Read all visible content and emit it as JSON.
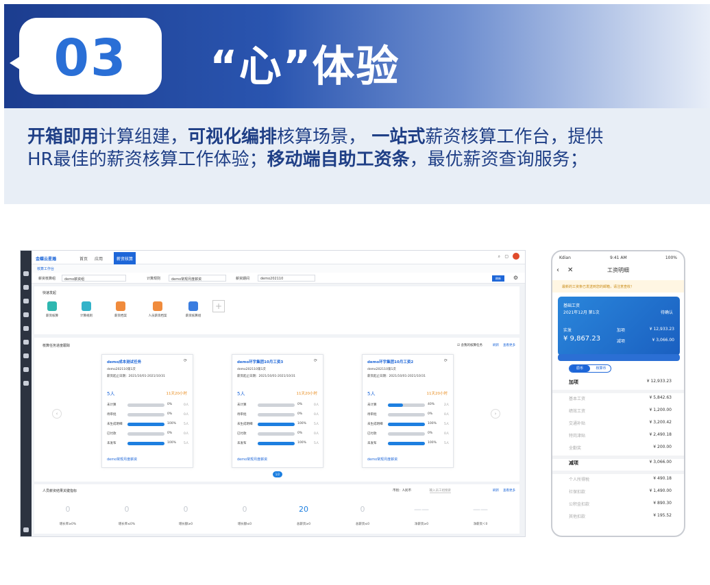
{
  "banner": {
    "number": "03",
    "title": "“心”体验"
  },
  "description": {
    "line1": [
      {
        "text": "开箱即用",
        "bold": true
      },
      {
        "text": "计算组建，",
        "bold": false
      },
      {
        "text": "可视化编排",
        "bold": true
      },
      {
        "text": "核算场景， ",
        "bold": false
      },
      {
        "text": "一站式",
        "bold": true
      },
      {
        "text": "薪资核算工作台，提供",
        "bold": false
      }
    ],
    "line2": [
      {
        "text": "HR最佳的薪资核算工作体验；",
        "bold": false
      },
      {
        "text": "移动端自助工资条",
        "bold": true
      },
      {
        "text": "，最优薪资查询服务；",
        "bold": false
      }
    ]
  },
  "desktop": {
    "logo": "金蝶云星瀚",
    "nav": [
      "首页",
      "应用"
    ],
    "active_tab": "薪资核算",
    "breadcrumb": "核算工作台",
    "filters": [
      {
        "label": "薪资核算组",
        "value": "demo薪资组"
      },
      {
        "label": "计算规则",
        "value": "demo常规月度薪资"
      },
      {
        "label": "薪资期间",
        "value": "demo202110"
      }
    ],
    "refresh_button": "刷新",
    "quick_title": "快速发起",
    "quick_actions": [
      {
        "label": "薪资核算",
        "color": "#2eb7b0"
      },
      {
        "label": "计算规则",
        "color": "#33b3c9"
      },
      {
        "label": "薪资档案",
        "color": "#f08b3c"
      },
      {
        "label": "人员薪资档案",
        "color": "#f08b3c"
      },
      {
        "label": "薪资核算组",
        "color": "#3a7de0"
      }
    ],
    "progress_title": "核算任务进度跟踪",
    "progress_options": [
      "含我的核算任务",
      "刷新",
      "查看更多"
    ],
    "cards": [
      {
        "title": "demo成本测试任务",
        "period_no": "demo202110第1次",
        "dates": "薪资起止日期：2021/10/01-2021/10/31",
        "count": "5人",
        "time": "11天20小时",
        "rows": [
          {
            "label": "未计算",
            "pct": 0,
            "pct_text": "0%",
            "people": "0人"
          },
          {
            "label": "待审批",
            "pct": 0,
            "pct_text": "0%",
            "people": "0人"
          },
          {
            "label": "未生成明细",
            "pct": 100,
            "pct_text": "100%",
            "people": "5人"
          },
          {
            "label": "已付款",
            "pct": 0,
            "pct_text": "0%",
            "people": "0人"
          },
          {
            "label": "未发布",
            "pct": 100,
            "pct_text": "100%",
            "people": "5人"
          }
        ],
        "footer": "demo常规月度薪资"
      },
      {
        "title": "demo环宇集团10月工资3",
        "period_no": "demo202110第1次",
        "dates": "薪资起止日期：2021/10/01-2021/10/31",
        "count": "5人",
        "time": "11天20小时",
        "rows": [
          {
            "label": "未计算",
            "pct": 0,
            "pct_text": "0%",
            "people": "0人"
          },
          {
            "label": "待审批",
            "pct": 0,
            "pct_text": "0%",
            "people": "0人"
          },
          {
            "label": "未生成明细",
            "pct": 100,
            "pct_text": "100%",
            "people": "5人"
          },
          {
            "label": "已付款",
            "pct": 0,
            "pct_text": "0%",
            "people": "0人"
          },
          {
            "label": "未发布",
            "pct": 100,
            "pct_text": "100%",
            "people": "5人"
          }
        ],
        "footer": "demo常规月度薪资"
      },
      {
        "title": "demo环宇集团10月工资2",
        "period_no": "demo202110第1次",
        "dates": "薪资起止日期：2021/10/01-2021/10/31",
        "count": "5人",
        "time": "11天20小时",
        "rows": [
          {
            "label": "未计算",
            "pct": 40,
            "pct_text": "40%",
            "people": "2人"
          },
          {
            "label": "待审批",
            "pct": 0,
            "pct_text": "0%",
            "people": "0人"
          },
          {
            "label": "未生成明细",
            "pct": 100,
            "pct_text": "100%",
            "people": "5人"
          },
          {
            "label": "已付款",
            "pct": 0,
            "pct_text": "0%",
            "people": "0人"
          },
          {
            "label": "未发布",
            "pct": 100,
            "pct_text": "100%",
            "people": "5人"
          }
        ],
        "footer": "demo常规月度薪资"
      }
    ],
    "page_indicator": "1/2",
    "results_title": "人员薪资结果关键指标",
    "results_options": [
      "币别：人民币",
      "输入员工组搜索",
      "刷新",
      "查看更多"
    ],
    "metrics": [
      {
        "value": "0",
        "label": "增长率≥0%"
      },
      {
        "value": "0",
        "label": "增长率≤0%"
      },
      {
        "value": "0",
        "label": "增长额≥0"
      },
      {
        "value": "0",
        "label": "增长额≤0"
      },
      {
        "value": "20",
        "label": "总薪资≥0"
      },
      {
        "value": "0",
        "label": "总薪资≤0"
      },
      {
        "value": "——",
        "label": "净薪资≥0"
      },
      {
        "value": "——",
        "label": "净薪资＜0"
      }
    ]
  },
  "phone": {
    "carrier": "Kdian",
    "time": "9:41 AM",
    "battery": "100%",
    "title": "工资明细",
    "notice": "最新的工资条已发送到您的邮箱，请注意查收！",
    "card": {
      "label": "基础工资",
      "period": "2021年12月 第1次",
      "sign": "待确认",
      "net_label": "实发",
      "net": "¥ 9,867.23",
      "add_label": "加项",
      "add_value": "¥ 12,933.23",
      "minus_label": "减项",
      "minus_value": "¥ 3,066.00"
    },
    "seg": [
      "原币",
      "核算币"
    ],
    "add_section": {
      "label": "加项",
      "value": "¥ 12,933.23"
    },
    "add_items": [
      {
        "label": "基本工资",
        "value": "¥ 5,842.63"
      },
      {
        "label": "绩效工资",
        "value": "¥ 1,200.00"
      },
      {
        "label": "交通补贴",
        "value": "¥ 3,200.42"
      },
      {
        "label": "特岗津贴",
        "value": "¥ 2,490.18"
      },
      {
        "label": "全勤奖",
        "value": "¥ 200.00"
      }
    ],
    "minus_section": {
      "label": "减项",
      "value": "¥ 3,066.00"
    },
    "minus_items": [
      {
        "label": "个人所得税",
        "value": "¥ 490.18"
      },
      {
        "label": "社保扣款",
        "value": "¥ 1,490.00"
      },
      {
        "label": "公积金扣款",
        "value": "¥ 890.30"
      },
      {
        "label": "其他扣款",
        "value": "¥ 195.52"
      }
    ]
  }
}
